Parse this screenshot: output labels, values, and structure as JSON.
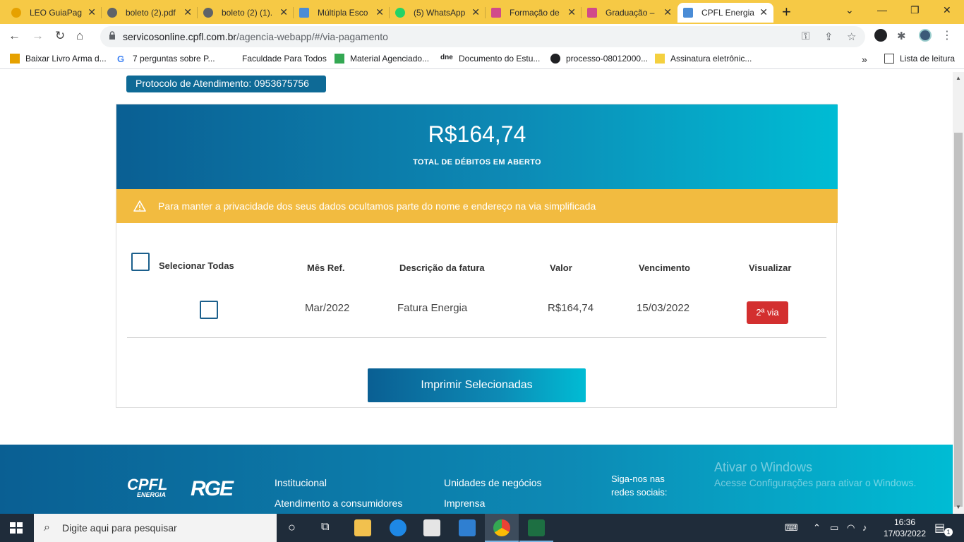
{
  "browser": {
    "tabs": [
      {
        "label": "LEO GuiaPag",
        "color": "#e6a100"
      },
      {
        "label": "boleto (2).pdf",
        "color": "#5f6368"
      },
      {
        "label": "boleto (2) (1).",
        "color": "#5f6368"
      },
      {
        "label": "Múltipla Esco",
        "color": "#4a8cd6"
      },
      {
        "label": "(5) WhatsApp",
        "color": "#25d366"
      },
      {
        "label": "Formação de",
        "color": "#d14a8a"
      },
      {
        "label": "Graduação –",
        "color": "#d14a8a"
      },
      {
        "label": "CPFL Energia",
        "color": "#4a8cd6"
      }
    ],
    "url_domain": "servicosonline.cpfl.com.br",
    "url_path": "/agencia-webapp/#/via-pagamento",
    "bookmarks": [
      "Baixar Livro Arma d...",
      "7 perguntas sobre P...",
      "Faculdade Para Todos",
      "Material Agenciado...",
      "Documento do Estu...",
      "processo-08012000...",
      "Assinatura eletrônic..."
    ],
    "reading_list": "Lista de leitura"
  },
  "page": {
    "protocolo": "Protocolo de Atendimento: 0953675756",
    "total_amount": "R$164,74",
    "total_label": "TOTAL DE DÉBITOS EM ABERTO",
    "privacy_notice": "Para manter a privacidade dos seus dados ocultamos parte do nome e endereço na via simplificada",
    "select_all": "Selecionar Todas",
    "headers": {
      "mes_ref": "Mês Ref.",
      "descricao": "Descrição da fatura",
      "valor": "Valor",
      "vencimento": "Vencimento",
      "visualizar": "Visualizar"
    },
    "rows": [
      {
        "mes_ref": "Mar/2022",
        "descricao": "Fatura Energia",
        "valor": "R$164,74",
        "vencimento": "15/03/2022",
        "action": "2ª via"
      }
    ],
    "print_button": "Imprimir Selecionadas"
  },
  "footer": {
    "logo_cpfl": "CPFL",
    "logo_cpfl_sub": "ENERGIA",
    "logo_rge": "RGE",
    "links_col1": [
      "Institucional",
      "Atendimento a consumidores"
    ],
    "links_col2": [
      "Unidades de negócios",
      "Imprensa"
    ],
    "social_line1": "Siga-nos nas",
    "social_line2": "redes sociais:",
    "activation_title": "Ativar o Windows",
    "activation_text": "Acesse Configurações para ativar o Windows."
  },
  "taskbar": {
    "search_placeholder": "Digite aqui para pesquisar",
    "time": "16:36",
    "date": "17/03/2022",
    "notification_count": "1"
  }
}
